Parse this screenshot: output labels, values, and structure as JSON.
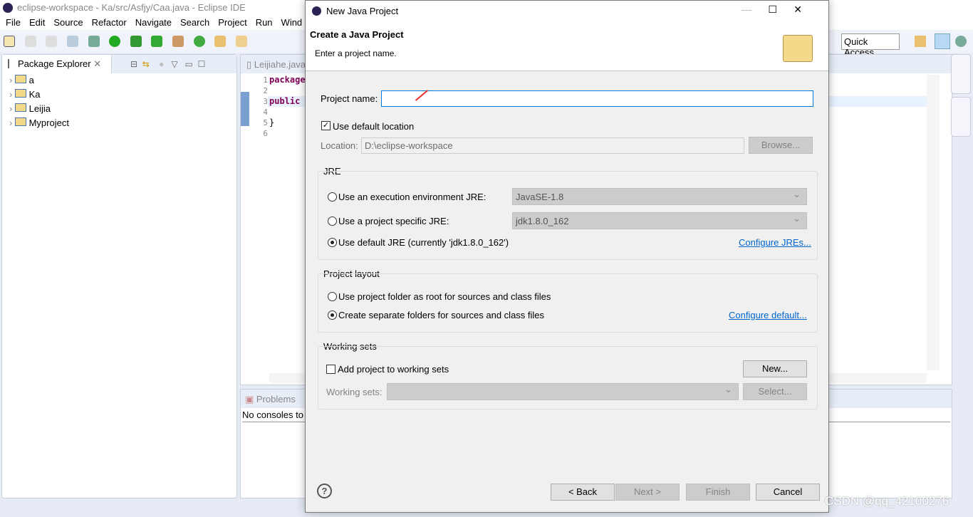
{
  "window": {
    "title": "eclipse-workspace - Ka/src/Asfjy/Caa.java - Eclipse IDE"
  },
  "menu": [
    "File",
    "Edit",
    "Source",
    "Refactor",
    "Navigate",
    "Search",
    "Project",
    "Run",
    "Wind"
  ],
  "quick_access": "Quick Access",
  "package_explorer": {
    "title": "Package Explorer",
    "projects": [
      "a",
      "Ka",
      "Leijia",
      "Myproject"
    ]
  },
  "editor": {
    "tab": "Leijiahe.java",
    "line_numbers": [
      "1",
      "2",
      "3",
      "4",
      "5",
      "6"
    ],
    "lines": [
      "package",
      "",
      "public",
      "",
      "}",
      ""
    ]
  },
  "console": {
    "tab": "Problems",
    "message": "No consoles to"
  },
  "dialog": {
    "title": "New Java Project",
    "heading": "Create a Java Project",
    "subheading": "Enter a project name.",
    "project_name_label": "Project name:",
    "project_name_value": "",
    "use_default_location": "Use default location",
    "use_default_location_checked": true,
    "location_label": "Location:",
    "location_value": "D:\\eclipse-workspace",
    "browse": "Browse...",
    "jre": {
      "title": "JRE",
      "option_env": "Use an execution environment JRE:",
      "env_value": "JavaSE-1.8",
      "option_specific": "Use a project specific JRE:",
      "specific_value": "jdk1.8.0_162",
      "option_default": "Use default JRE (currently 'jdk1.8.0_162')",
      "selected": "default",
      "configure": "Configure JREs..."
    },
    "layout": {
      "title": "Project layout",
      "option_root": "Use project folder as root for sources and class files",
      "option_separate": "Create separate folders for sources and class files",
      "selected": "separate",
      "configure": "Configure default..."
    },
    "working_sets": {
      "title": "Working sets",
      "add_label": "Add project to working sets",
      "add_checked": false,
      "new": "New...",
      "sets_label": "Working sets:",
      "select": "Select..."
    },
    "buttons": {
      "back": "< Back",
      "next": "Next >",
      "finish": "Finish",
      "cancel": "Cancel"
    }
  },
  "watermark": "CSDN @qq_42100276"
}
